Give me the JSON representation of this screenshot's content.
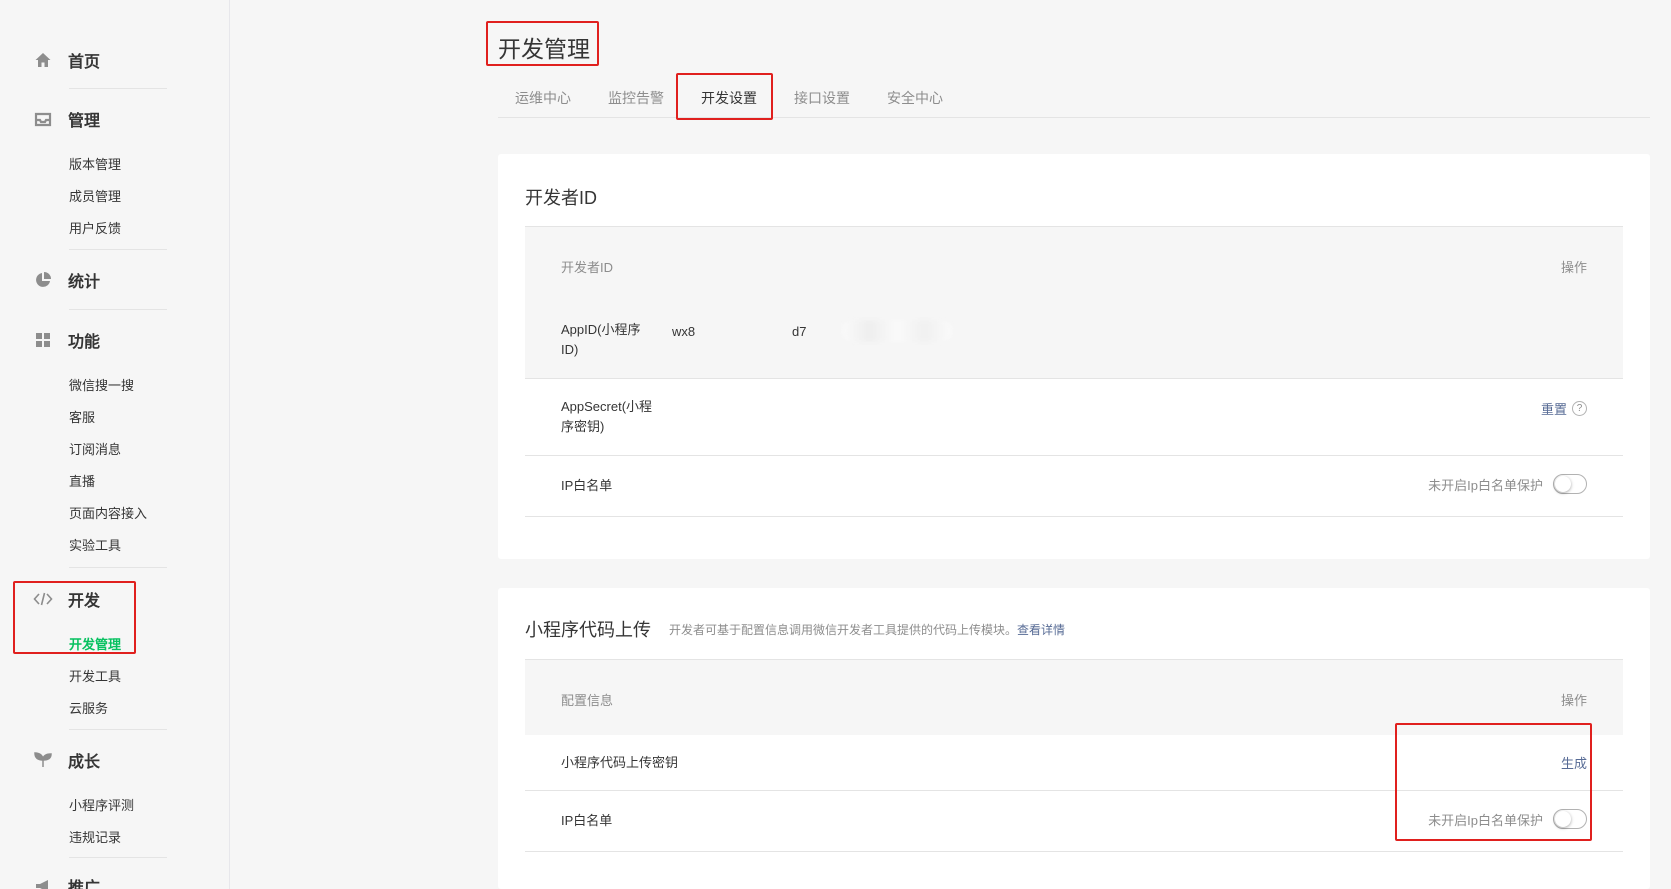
{
  "sidebar": {
    "home": {
      "label": "首页",
      "icon": "home-icon"
    },
    "manage": {
      "label": "管理",
      "icon": "inbox-icon",
      "items": [
        "版本管理",
        "成员管理",
        "用户反馈"
      ]
    },
    "stats": {
      "label": "统计",
      "icon": "pie-chart-icon"
    },
    "features": {
      "label": "功能",
      "icon": "grid-icon",
      "items": [
        "微信搜一搜",
        "客服",
        "订阅消息",
        "直播",
        "页面内容接入",
        "实验工具"
      ]
    },
    "dev": {
      "label": "开发",
      "icon": "code-icon",
      "items": [
        "开发管理",
        "开发工具",
        "云服务"
      ],
      "active_item": "开发管理"
    },
    "growth": {
      "label": "成长",
      "icon": "sprout-icon",
      "items": [
        "小程序评测",
        "违规记录"
      ]
    },
    "promo": {
      "label": "推广",
      "icon": "megaphone-icon"
    }
  },
  "main": {
    "title": "开发管理",
    "tabs": [
      "运维中心",
      "监控告警",
      "开发设置",
      "接口设置",
      "安全中心"
    ],
    "active_tab": "开发设置"
  },
  "developer_card": {
    "title": "开发者ID",
    "col_left": "开发者ID",
    "col_right": "操作",
    "appid_label": "AppID(小程序ID)",
    "appid_prefix": "wx8",
    "appid_suffix": "d7",
    "secret_label": "AppSecret(小程序密钥)",
    "secret_action": "重置",
    "help_glyph": "?",
    "ip_label": "IP白名单",
    "ip_status": "未开启Ip白名单保护",
    "ip_enabled": false
  },
  "upload_card": {
    "title": "小程序代码上传",
    "desc": "开发者可基于配置信息调用微信开发者工具提供的代码上传模块。",
    "desc_link": "查看详情",
    "col_left": "配置信息",
    "col_right": "操作",
    "key_label": "小程序代码上传密钥",
    "key_action": "生成",
    "ip_label": "IP白名单",
    "ip_status": "未开启Ip白名单保护",
    "ip_enabled": false
  },
  "colors": {
    "accent_green": "#07c160",
    "link_blue": "#576b95",
    "highlight_red": "#e0201e"
  }
}
